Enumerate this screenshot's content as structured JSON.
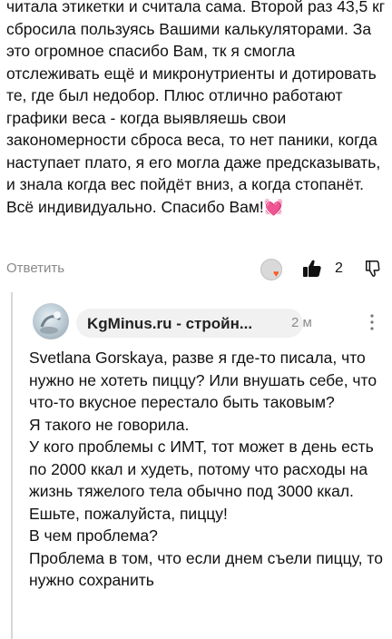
{
  "top_comment": {
    "text": "читала этикетки и считала сама. Второй раз 43,5 кг сбросила пользуясь Вашими калькуляторами. За это огромное спасибо Вам, тк я смогла отслеживать ещё и микронутриенты и дотировать те, где был недобор. Плюс отлично работают графики веса - когда выявляешь свои закономерности сброса веса, то нет паники, когда наступает плато, я его могла даже предсказывать, и знала когда вес пойдёт вниз, а когда стопанёт. Всё индивидуально. Спасибо Вам!💓",
    "reply_label": "Ответить",
    "like_count": "2"
  },
  "reply": {
    "author": "KgMinus.ru - стройн...",
    "time": "2 м",
    "lines": [
      "Svetlana Gorskaya, разве я где-то писала, что нужно не хотеть пиццу? Или внушать себе, что что-то вкусное перестало быть таковым?",
      "Я такого не говорила.",
      "У кого проблемы с ИМТ, тот может в день есть по 2000 ккал и худеть, потому что расходы на жизнь тяжелого тела обычно под 3000 ккал.",
      "Ешьте, пожалуйста, пиццу!",
      "В чем проблема?",
      "Проблема в том, что если днем съели пиццу, то нужно сохранить"
    ]
  },
  "colors": {
    "text": "#111111",
    "muted": "#8a8a8a",
    "heart": "#ff5a1f",
    "pill": "#f1f1f1",
    "thread_line": "#d7d7d7"
  },
  "icons": [
    "reactor-avatar",
    "heart-icon",
    "thumbs-up-icon",
    "thumbs-down-icon",
    "more-vertical-icon"
  ]
}
